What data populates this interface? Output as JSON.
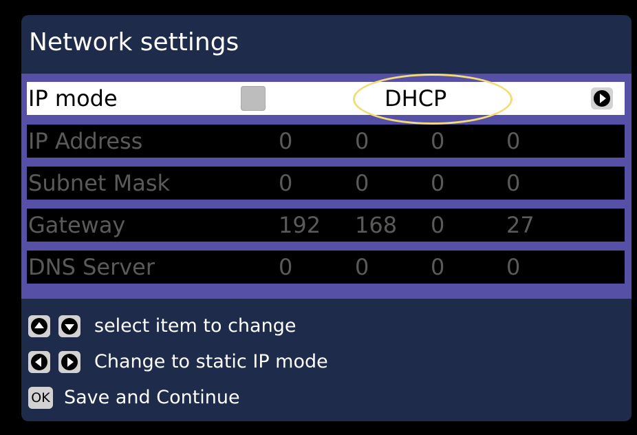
{
  "screen": {
    "title": "Network settings"
  },
  "colors": {
    "background": "#000000",
    "panel": "#1f2b4a",
    "settings_border": "#5650a6",
    "selected_row": "#ffffff",
    "disabled_text": "#5a5a5a",
    "highlight": "#f3dc78"
  },
  "rows": [
    {
      "label": "IP mode",
      "value": "DHCP",
      "selected": true,
      "left_icon": "left-arrow-disabled",
      "right_icon": "right-arrow-icon"
    },
    {
      "label": "IP Address",
      "octets": [
        "0",
        "0",
        "0",
        "0"
      ],
      "enabled": false
    },
    {
      "label": "Subnet Mask",
      "octets": [
        "0",
        "0",
        "0",
        "0"
      ],
      "enabled": false
    },
    {
      "label": "Gateway",
      "octets": [
        "192",
        "168",
        "0",
        "27"
      ],
      "enabled": false
    },
    {
      "label": "DNS Server",
      "octets": [
        "0",
        "0",
        "0",
        "0"
      ],
      "enabled": false
    }
  ],
  "help": [
    {
      "icons": [
        "up-arrow-icon",
        "down-arrow-icon"
      ],
      "text": "select item to change"
    },
    {
      "icons": [
        "left-arrow-icon",
        "right-arrow-icon"
      ],
      "text": "Change to static IP mode"
    },
    {
      "badge": "OK",
      "icons": [
        "ok-button-icon"
      ],
      "text": "Save and Continue"
    }
  ]
}
